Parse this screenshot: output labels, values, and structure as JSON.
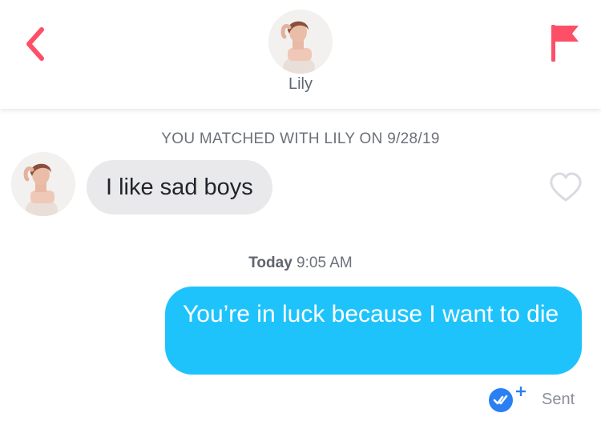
{
  "header": {
    "back_icon": "chevron-left-icon",
    "match_name": "Lily",
    "flag_icon": "flag-icon",
    "accent_color": "#fd5068"
  },
  "chat": {
    "match_notice": "YOU MATCHED WITH LILY ON 9/28/19",
    "messages": [
      {
        "direction": "incoming",
        "text": "I like sad boys",
        "like_icon": "heart-outline-icon"
      },
      {
        "direction": "outgoing",
        "text": "You’re in luck because I want to die"
      }
    ],
    "timestamp": {
      "day": "Today",
      "time": "9:05 AM"
    },
    "status": {
      "icon": "read-receipt-icon",
      "label": "Sent"
    },
    "colors": {
      "incoming_bubble": "#e9e9eb",
      "outgoing_bubble": "#1ec3fc",
      "read_badge": "#2a7ff2"
    }
  }
}
